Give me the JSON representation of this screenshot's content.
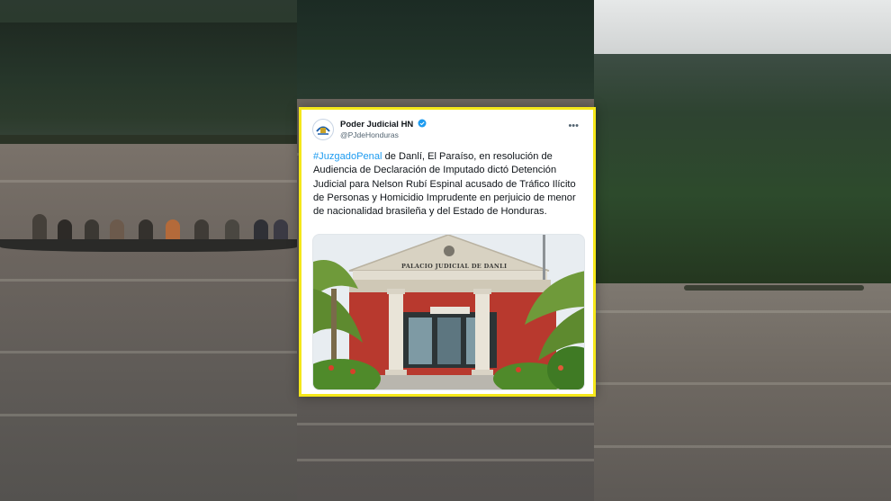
{
  "tweet": {
    "author_name": "Poder Judicial HN",
    "author_handle": "@PJdeHonduras",
    "verified_icon": "verified-badge-icon",
    "more_icon": "more-horizontal-icon",
    "hashtag": "#JuzgadoPenal",
    "text_after_hashtag": " de Danlí, El Paraíso, en resolución de Audiencia de Declaración de Imputado dictó Detención Judicial para Nelson Rubí Espinal acusado de Tráfico Ilícito de Personas y Homicidio Imprudente en perjuicio de menor de nacionalidad brasileña y del Estado de Honduras.",
    "image_sign_text": "PALACIO JUDICIAL DE DANLI"
  },
  "colors": {
    "frame_border": "#f5e71a",
    "hashtag": "#1d9bf0",
    "verified": "#1d9bf0",
    "text": "#0f1419",
    "secondary": "#536471"
  }
}
